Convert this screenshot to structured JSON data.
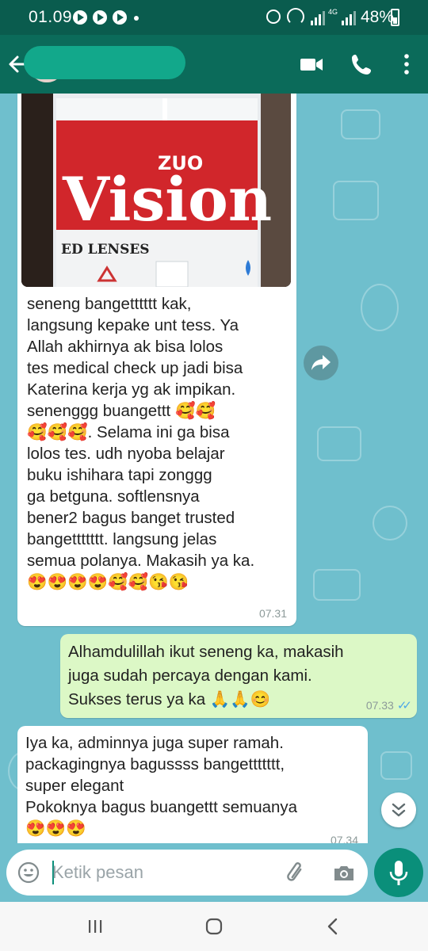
{
  "status_bar": {
    "time": "01.09",
    "network": "4G",
    "battery": "48%"
  },
  "app_bar": {
    "contact_name": "",
    "icons": [
      "back-arrow-icon",
      "video-call-icon",
      "phone-icon",
      "more-options-icon"
    ]
  },
  "messages": [
    {
      "direction": "incoming",
      "image_text": {
        "brand_small": "ZUO",
        "brand_big": "Vision",
        "label": "ED LENSES"
      },
      "text": "seneng bangetttttt kak,\nlangsung kepake unt tess. Ya\nAllah akhirnya ak bisa lolos\ntes medical check up jadi bisa\nKaterina kerja yg ak impikan.\nsenenggg buangettt 🥰🥰\n🥰🥰🥰. Selama ini ga bisa\nlolos tes. udh nyoba belajar\nbuku ishihara tapi zonggg\nga betguna. softlensnya\nbener2 bagus banget trusted\nbangettttttt. langsung jelas\nsemua polanya. Makasih ya ka.\n😍😍😍😍🥰🥰😘😘",
      "time": "07.31"
    },
    {
      "direction": "outgoing",
      "text": "Alhamdulillah ikut seneng ka, makasih\njuga sudah percaya dengan kami.\nSukses terus ya ka 🙏🙏😊",
      "time": "07.33",
      "ticks": "✓✓"
    },
    {
      "direction": "incoming",
      "text": "Iya ka, adminnya juga super ramah.\npackagingnya bagussss bangettttttt,\nsuper elegant\nPokoknya bagus buangettt semuanya\n😍😍😍",
      "time": "07.34"
    }
  ],
  "composer": {
    "placeholder": "Ketik pesan",
    "icons": [
      "emoji-icon",
      "attach-icon",
      "camera-icon",
      "mic-icon"
    ]
  },
  "nav": [
    "recent-apps-icon",
    "home-icon",
    "back-icon"
  ]
}
